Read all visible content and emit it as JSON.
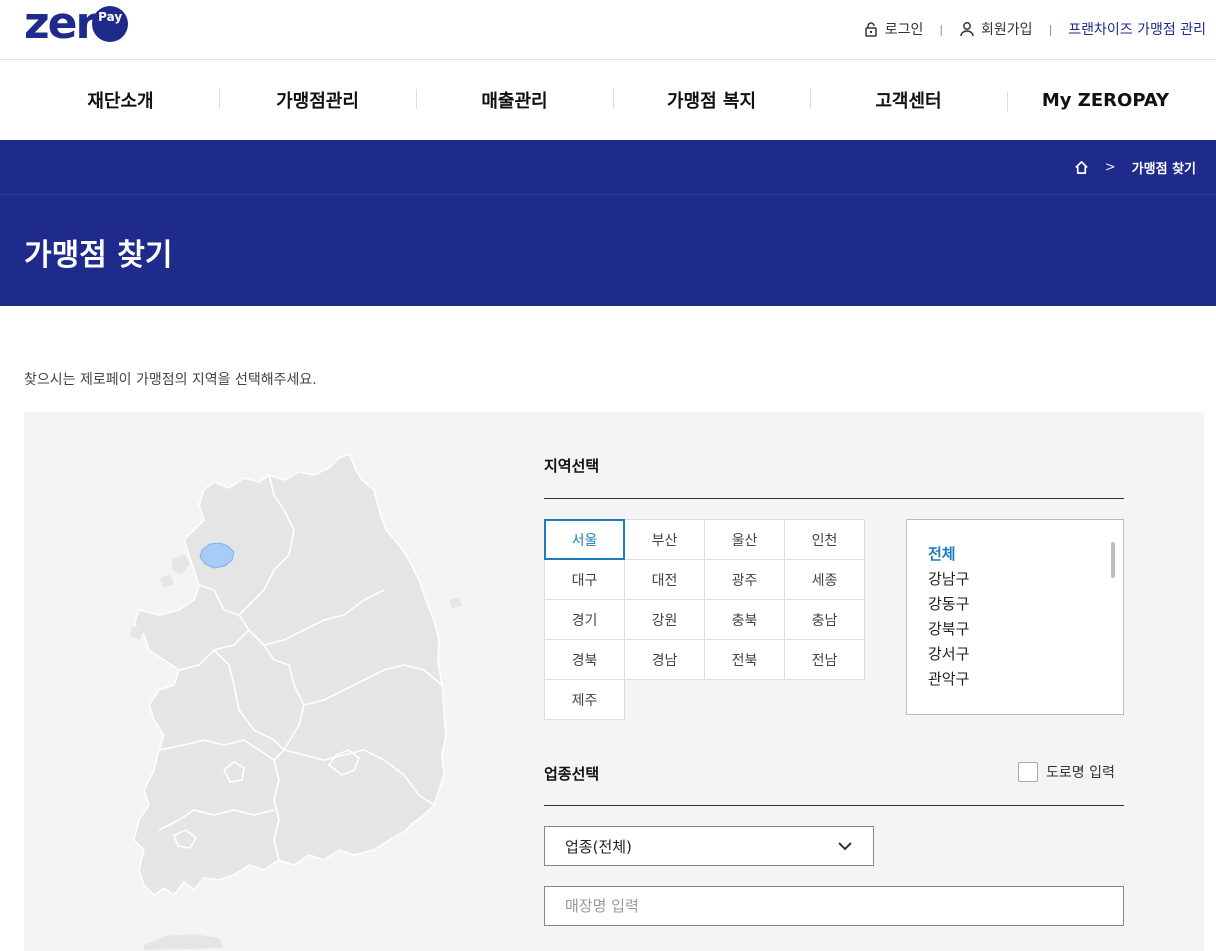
{
  "brand": {
    "logo_text": "zer",
    "logo_badge": "Pay"
  },
  "util": {
    "login": "로그인",
    "signup": "회원가입",
    "franchise": "프랜차이즈 가맹점 관리"
  },
  "gnb": [
    "재단소개",
    "가맹점관리",
    "매출관리",
    "가맹점 복지",
    "고객센터",
    "My ZEROPAY"
  ],
  "breadcrumb": {
    "current": "가맹점 찾기",
    "separator": ">"
  },
  "page_title": "가맹점 찾기",
  "intro": "찾으시는 제로페이 가맹점의 지역을 선택해주세요.",
  "region": {
    "title": "지역선택",
    "selected": "서울",
    "items": [
      "서울",
      "부산",
      "울산",
      "인천",
      "대구",
      "대전",
      "광주",
      "세종",
      "경기",
      "강원",
      "충북",
      "충남",
      "경북",
      "경남",
      "전북",
      "전남",
      "제주"
    ]
  },
  "district": {
    "selected": "전체",
    "items": [
      "전체",
      "강남구",
      "강동구",
      "강북구",
      "강서구",
      "관악구"
    ]
  },
  "business": {
    "title": "업종선택",
    "road_checkbox_label": "도로명 입력",
    "select_value": "업종(전체)",
    "name_placeholder": "매장명 입력"
  },
  "colors": {
    "brand_navy": "#1e2a8c",
    "accent_blue": "#1e7dbe",
    "map_fill": "#e5e5e5",
    "map_selected": "#a7cdf7"
  },
  "icons": {
    "login": "lock-icon",
    "signup": "person-icon",
    "home": "home-icon",
    "select": "chevron-down-icon"
  }
}
